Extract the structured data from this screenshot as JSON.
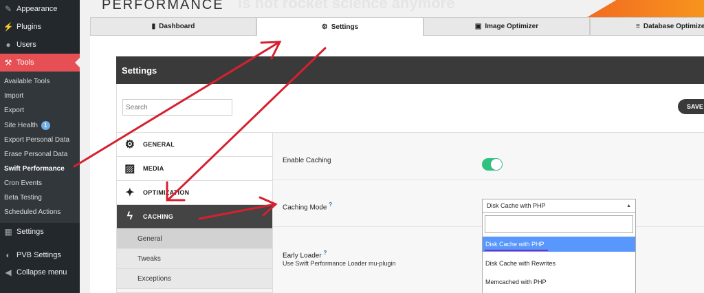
{
  "sidebar": {
    "items": [
      {
        "label": "Appearance",
        "icon": "paintbrush-icon",
        "glyph": "✎"
      },
      {
        "label": "Plugins",
        "icon": "plug-icon",
        "glyph": "⚡"
      },
      {
        "label": "Users",
        "icon": "user-icon",
        "glyph": "●"
      },
      {
        "label": "Tools",
        "icon": "wrench-icon",
        "glyph": "🔧"
      }
    ],
    "submenu": [
      {
        "label": "Available Tools"
      },
      {
        "label": "Import"
      },
      {
        "label": "Export"
      },
      {
        "label": "Site Health",
        "badge": "1"
      },
      {
        "label": "Export Personal Data"
      },
      {
        "label": "Erase Personal Data"
      },
      {
        "label": "Swift Performance"
      },
      {
        "label": "Cron Events"
      },
      {
        "label": "Beta Testing"
      },
      {
        "label": "Scheduled Actions"
      }
    ],
    "bottom": [
      {
        "label": "Settings",
        "icon": "settings-icon",
        "glyph": "▦"
      },
      {
        "label": "PVB Settings",
        "icon": "pvb-icon",
        "glyph": "◐"
      },
      {
        "label": "Collapse menu",
        "icon": "collapse-icon",
        "glyph": "◀"
      }
    ]
  },
  "header": {
    "brand": "PERFORMANCE",
    "tagline": "is not rocket science anymore"
  },
  "tabs": [
    {
      "label": "Dashboard",
      "icon": "clipboard-icon",
      "glyph": "▮"
    },
    {
      "label": "Settings",
      "icon": "gears-icon",
      "glyph": "⚙"
    },
    {
      "label": "Image Optimizer",
      "icon": "images-icon",
      "glyph": "▣"
    },
    {
      "label": "Database Optimizer",
      "icon": "database-icon",
      "glyph": "≡"
    }
  ],
  "panel": {
    "title": "Settings",
    "search_placeholder": "Search",
    "save_label": "SAVE"
  },
  "left_menu": {
    "items": [
      {
        "label": "GENERAL",
        "icon": "gear-icon",
        "glyph": "⚙"
      },
      {
        "label": "MEDIA",
        "icon": "image-icon",
        "glyph": "▨"
      },
      {
        "label": "OPTIMIZATION",
        "icon": "magic-wand-icon",
        "glyph": "✦"
      },
      {
        "label": "CACHING",
        "icon": "bolt-icon",
        "glyph": "ϟ"
      }
    ],
    "caching_sub": [
      {
        "label": "General"
      },
      {
        "label": "Tweaks"
      },
      {
        "label": "Exceptions"
      }
    ]
  },
  "fields": {
    "enable_caching": {
      "label": "Enable Caching",
      "enabled": true
    },
    "caching_mode": {
      "label": "Caching Mode",
      "help": "?",
      "selected": "Disk Cache with PHP",
      "options": [
        "Disk Cache with PHP",
        "Disk Cache with Rewrites",
        "Memcached with PHP"
      ]
    },
    "early_loader": {
      "label": "Early Loader",
      "help": "?",
      "description": "Use Swift Performance Loader mu-plugin"
    }
  },
  "colors": {
    "accent": "#e65054",
    "sidebar": "#23282d",
    "toggle_on": "#2ec27e",
    "highlight": "#5897fb",
    "annotation_arrow": "#d6202f",
    "annotation_underline": "#8b2bb5"
  }
}
